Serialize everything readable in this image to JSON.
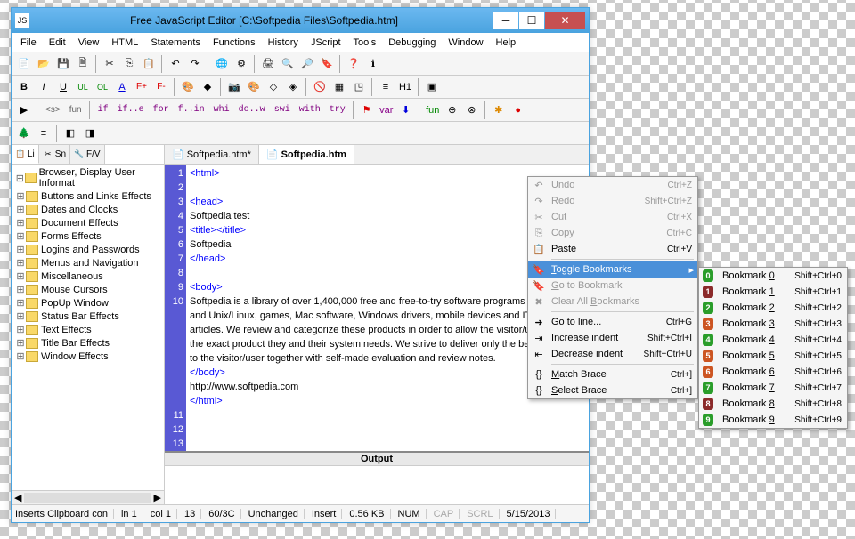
{
  "window": {
    "title": "Free JavaScript Editor     [C:\\Softpedia Files\\Softpedia.htm]"
  },
  "menu": [
    "File",
    "Edit",
    "View",
    "HTML",
    "Statements",
    "Functions",
    "History",
    "JScript",
    "Tools",
    "Debugging",
    "Window",
    "Help"
  ],
  "sidetabs": [
    {
      "label": "Li",
      "icon": "📋"
    },
    {
      "label": "Sn",
      "icon": "✂"
    },
    {
      "label": "F/V",
      "icon": "🔧"
    }
  ],
  "tree": [
    "Browser, Display User Informat",
    "Buttons and Links Effects",
    "Dates and Clocks",
    "Document Effects",
    "Forms Effects",
    "Logins and Passwords",
    "Menus and Navigation",
    "Miscellaneous",
    "Mouse Cursors",
    "PopUp Window",
    "Status Bar Effects",
    "Text Effects",
    "Title Bar Effects",
    "Window Effects"
  ],
  "edtabs": [
    {
      "label": "Softpedia.htm*",
      "active": false
    },
    {
      "label": "Softpedia.htm",
      "active": true
    }
  ],
  "code_lines": [
    "<html>",
    "",
    "<head>",
    "Softpedia test",
    "<title></title>",
    "Softpedia",
    "</head>",
    "",
    "<body>",
    "Softpedia is a library of over 1,400,000 free and free-to-try software programs for Windows and Unix/Linux, games, Mac software, Windows drivers, mobile devices and IT-related articles. We review and categorize these products in order to allow the visitor/user to find the exact product they and their system needs. We strive to deliver only the best products to the visitor/user together with self-made evaluation and review notes.",
    "</body>",
    "http://www.softpedia.com",
    "</html>"
  ],
  "output": {
    "title": "Output"
  },
  "status": {
    "hint": "Inserts Clipboard con",
    "ln": "ln 1",
    "col": "col 1",
    "sel": "13",
    "pos": "60/3C",
    "changed": "Unchanged",
    "mode": "Insert",
    "size": "0.56 KB",
    "num": "NUM",
    "cap": "CAP",
    "scrl": "SCRL",
    "date": "5/15/2013"
  },
  "ctx": [
    {
      "type": "item",
      "label": "Undo",
      "key": "U",
      "shortcut": "Ctrl+Z",
      "icon": "↶",
      "disabled": true
    },
    {
      "type": "item",
      "label": "Redo",
      "key": "R",
      "shortcut": "Shift+Ctrl+Z",
      "icon": "↷",
      "disabled": true
    },
    {
      "type": "item",
      "label": "Cut",
      "key": "t",
      "shortcut": "Ctrl+X",
      "icon": "✂",
      "disabled": true
    },
    {
      "type": "item",
      "label": "Copy",
      "key": "C",
      "shortcut": "Ctrl+C",
      "icon": "⎘",
      "disabled": true
    },
    {
      "type": "item",
      "label": "Paste",
      "key": "P",
      "shortcut": "Ctrl+V",
      "icon": "📋"
    },
    {
      "type": "sep"
    },
    {
      "type": "item",
      "label": "Toggle Bookmarks",
      "key": "T",
      "icon": "🔖",
      "hover": true,
      "arrow": true
    },
    {
      "type": "item",
      "label": "Go to Bookmark",
      "key": "G",
      "icon": "🔖",
      "disabled": true
    },
    {
      "type": "item",
      "label": "Clear All Bookmarks",
      "key": "B",
      "icon": "✖",
      "disabled": true
    },
    {
      "type": "sep"
    },
    {
      "type": "item",
      "label": "Go to line...",
      "key": "l",
      "shortcut": "Ctrl+G",
      "icon": "➜"
    },
    {
      "type": "item",
      "label": "Increase indent",
      "key": "I",
      "shortcut": "Shift+Ctrl+I",
      "icon": "⇥"
    },
    {
      "type": "item",
      "label": "Decrease indent",
      "key": "D",
      "shortcut": "Shift+Ctrl+U",
      "icon": "⇤"
    },
    {
      "type": "sep"
    },
    {
      "type": "item",
      "label": "Match Brace",
      "key": "M",
      "shortcut": "Ctrl+]",
      "icon": "{}"
    },
    {
      "type": "item",
      "label": "Select Brace",
      "key": "S",
      "shortcut": "Ctrl+]",
      "icon": "{}"
    }
  ],
  "sub": [
    {
      "label": "Bookmark 0",
      "shortcut": "Shift+Ctrl+0",
      "color": "#2a9d2a"
    },
    {
      "label": "Bookmark 1",
      "shortcut": "Shift+Ctrl+1",
      "color": "#8b2a2a"
    },
    {
      "label": "Bookmark 2",
      "shortcut": "Shift+Ctrl+2",
      "color": "#2a9d2a"
    },
    {
      "label": "Bookmark 3",
      "shortcut": "Shift+Ctrl+3",
      "color": "#cc5522"
    },
    {
      "label": "Bookmark 4",
      "shortcut": "Shift+Ctrl+4",
      "color": "#2a9d2a"
    },
    {
      "label": "Bookmark 5",
      "shortcut": "Shift+Ctrl+5",
      "color": "#cc5522"
    },
    {
      "label": "Bookmark 6",
      "shortcut": "Shift+Ctrl+6",
      "color": "#cc5522"
    },
    {
      "label": "Bookmark 7",
      "shortcut": "Shift+Ctrl+7",
      "color": "#2a9d2a"
    },
    {
      "label": "Bookmark 8",
      "shortcut": "Shift+Ctrl+8",
      "color": "#8b2a2a"
    },
    {
      "label": "Bookmark 9",
      "shortcut": "Shift+Ctrl+9",
      "color": "#2a9d2a"
    }
  ],
  "toolbar3": [
    "B",
    "I",
    "U",
    "UL",
    "OL",
    "A",
    "F+",
    "F-"
  ],
  "toolbar4_scripts": [
    "<s>",
    "fun",
    "if",
    "if..e",
    "for",
    "f..in",
    "whi",
    "do..w",
    "swi",
    "with",
    "try"
  ]
}
